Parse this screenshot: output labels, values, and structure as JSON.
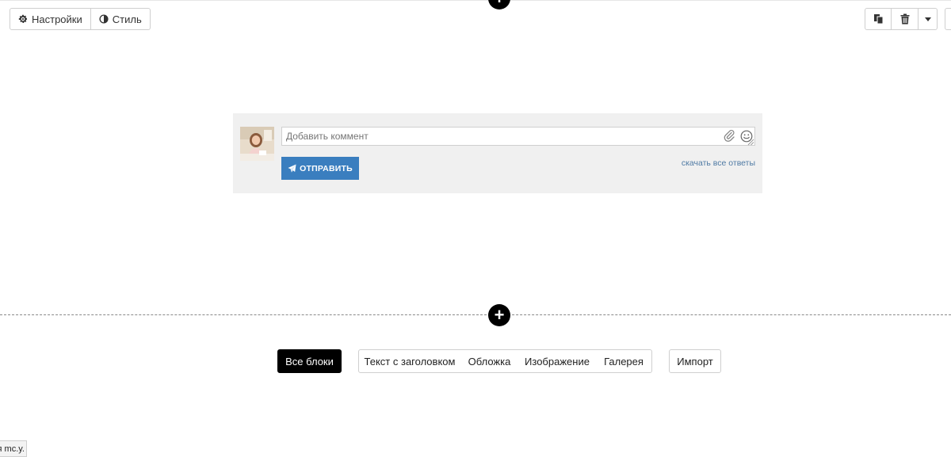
{
  "toolbar": {
    "settings_label": "Настройки",
    "style_label": "Стиль",
    "settings_icon": "gear-icon",
    "style_icon": "contrast-icon",
    "right_icons": [
      "duplicate-icon",
      "trash-icon",
      "caret-down-icon"
    ]
  },
  "comment_widget": {
    "input_placeholder": "Добавить коммент",
    "send_label": "ОТПРАВИТЬ",
    "send_icon": "paper-plane-icon",
    "download_link": "скачать все ответы"
  },
  "block_tabs": {
    "all": "Все блоки",
    "items": [
      "Текст с заголовком",
      "Обложка",
      "Изображение",
      "Галерея"
    ],
    "import": "Импорт"
  },
  "status_bar": {
    "text": "я mc.y."
  },
  "colors": {
    "send_button": "#3a7ebf",
    "link": "#4f7aa4",
    "comment_bg": "#f0f0f0",
    "active_tab": "#000000"
  }
}
